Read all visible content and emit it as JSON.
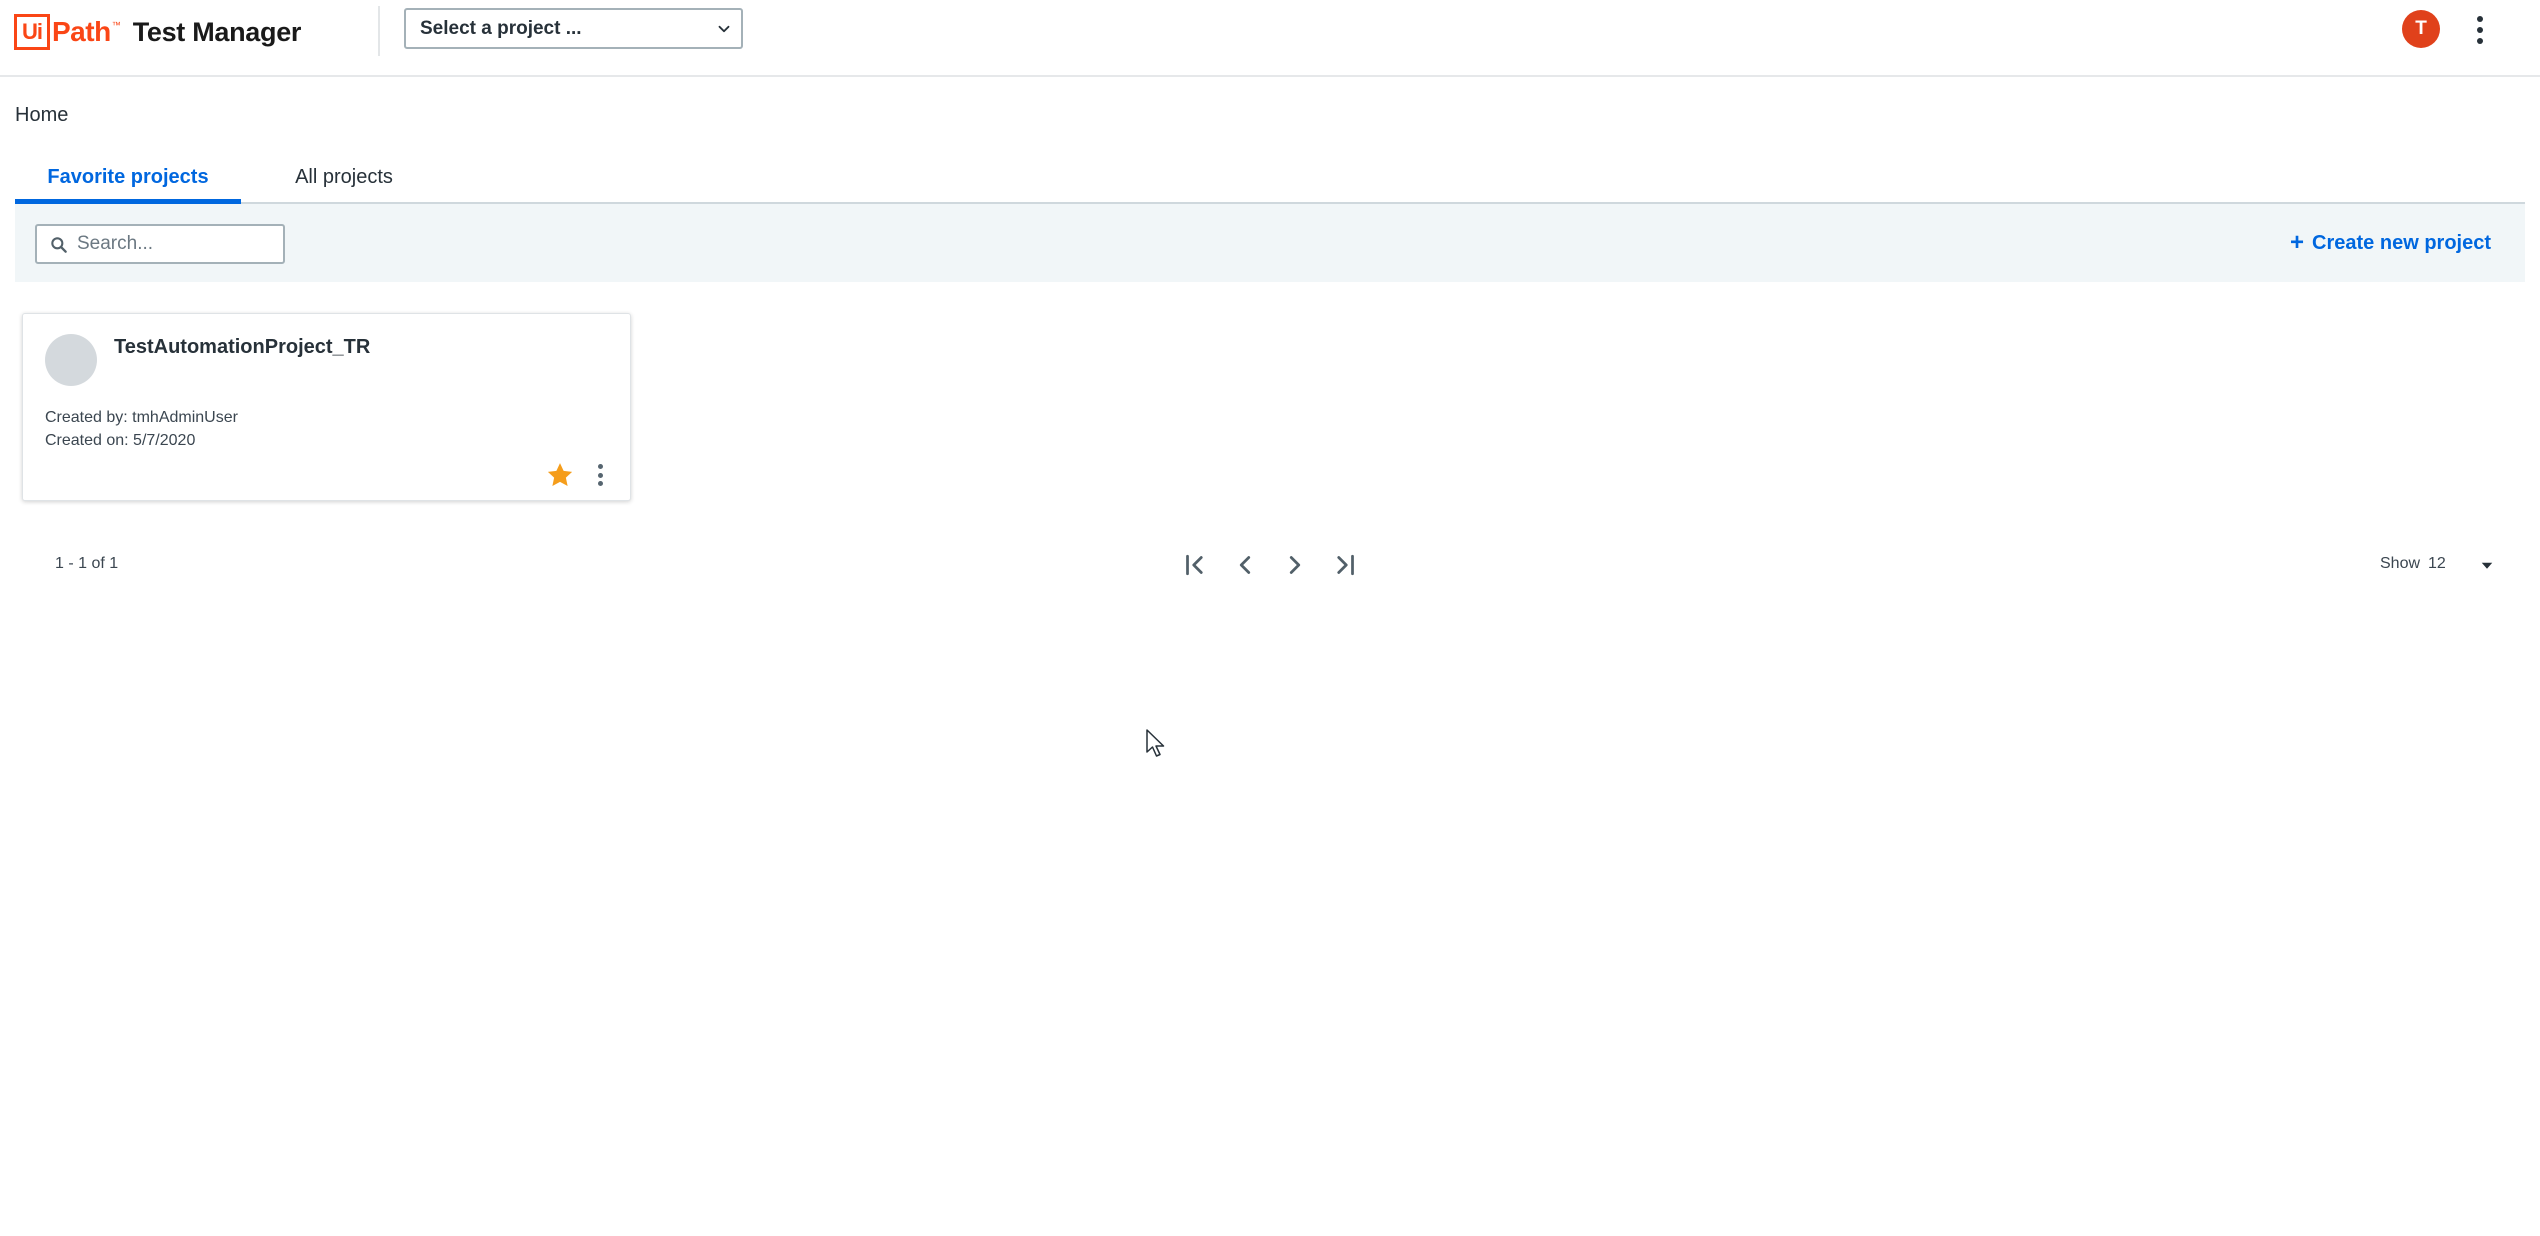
{
  "app": {
    "brand": "UiPath",
    "product": "Test Manager",
    "trademark": "™"
  },
  "header": {
    "project_select_placeholder": "Select a project ...",
    "user_initial": "T"
  },
  "breadcrumb": {
    "current": "Home"
  },
  "tabs": [
    {
      "label": "Favorite projects",
      "active": true
    },
    {
      "label": "All projects",
      "active": false
    }
  ],
  "toolbar": {
    "search_placeholder": "Search...",
    "create_label": "Create new project",
    "create_icon": "+"
  },
  "projects": [
    {
      "name": "TestAutomationProject_TR",
      "created_by": "Created by: tmhAdminUser",
      "created_on": "Created on: 5/7/2020",
      "favorite": true
    }
  ],
  "pagination": {
    "range": "1 - 1 of 1",
    "show_label": "Show",
    "page_size": "12"
  },
  "colors": {
    "brand": "#fa4616",
    "accent": "#0067df",
    "avatar": "#e0411b",
    "star": "#f59d1b",
    "toolbar_bg": "#f1f6f8"
  },
  "icons": [
    "chevron-down-icon",
    "search-icon",
    "plus-icon",
    "star-icon",
    "more-vert-icon",
    "first-page-icon",
    "prev-page-icon",
    "next-page-icon",
    "last-page-icon",
    "caret-down-icon"
  ]
}
